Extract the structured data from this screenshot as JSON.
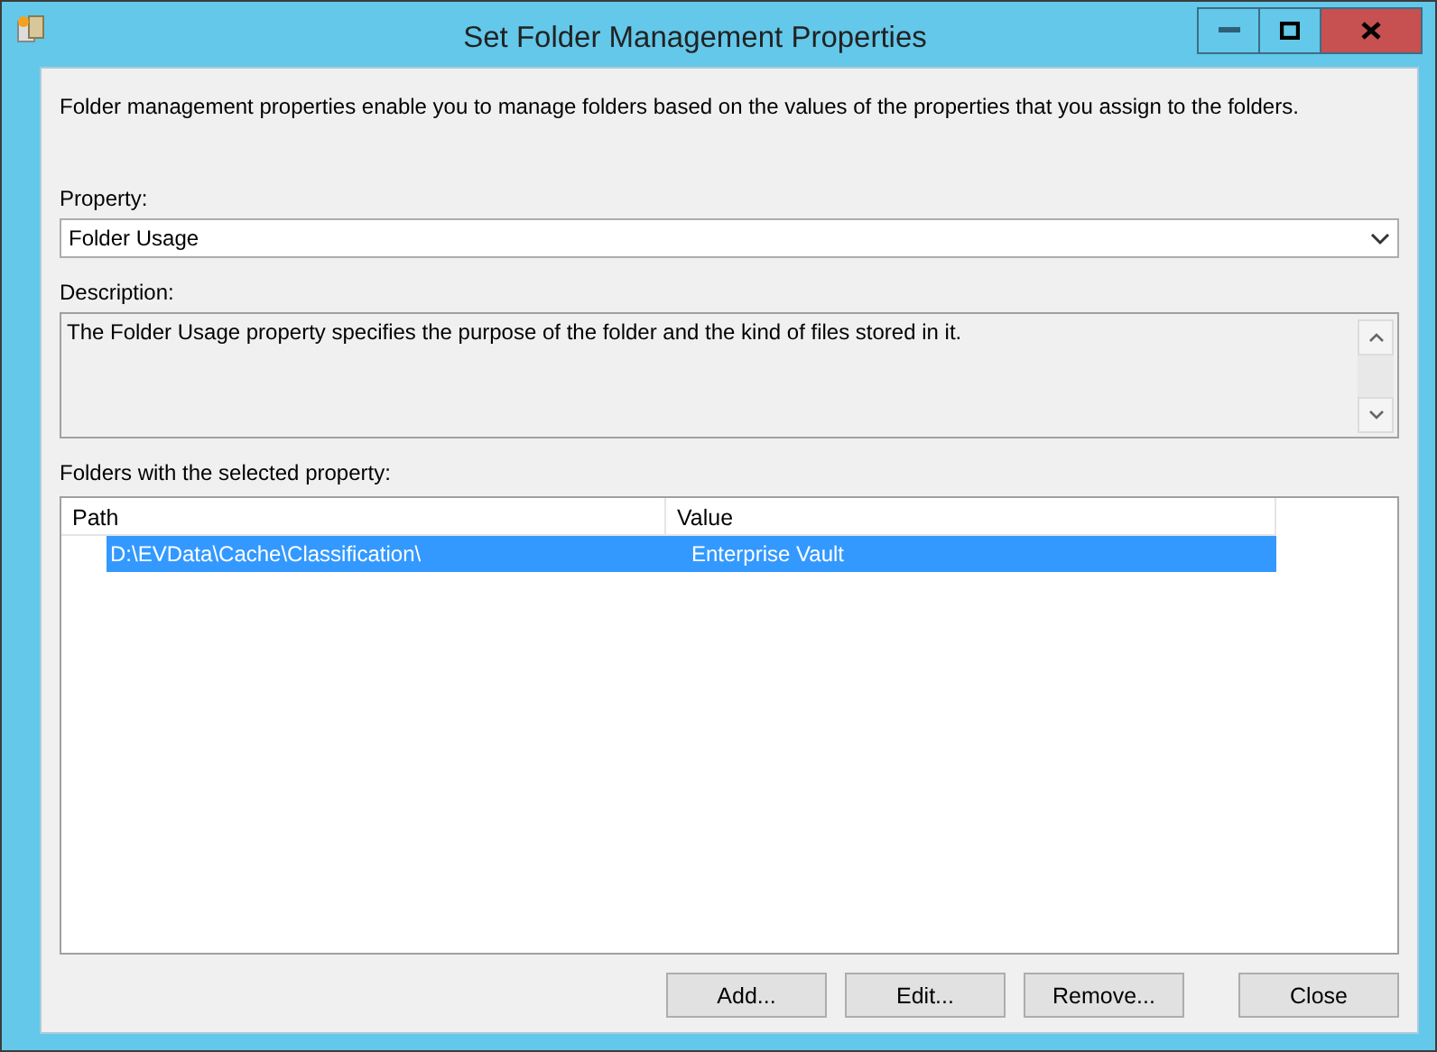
{
  "window": {
    "title": "Set Folder Management Properties"
  },
  "intro": "Folder management properties enable you to manage folders based on the values of the properties that you assign to the folders.",
  "property": {
    "label": "Property:",
    "value": "Folder Usage"
  },
  "description": {
    "label": "Description:",
    "value": "The Folder Usage property specifies the purpose of the folder and the kind of files stored in it."
  },
  "folders": {
    "label": "Folders with the selected property:",
    "columns": [
      "Path",
      "Value"
    ],
    "rows": [
      {
        "path": "D:\\EVData\\Cache\\Classification\\",
        "value": "Enterprise Vault",
        "selected": true
      }
    ]
  },
  "buttons": [
    "Add...",
    "Edit...",
    "Remove...",
    "Close"
  ]
}
